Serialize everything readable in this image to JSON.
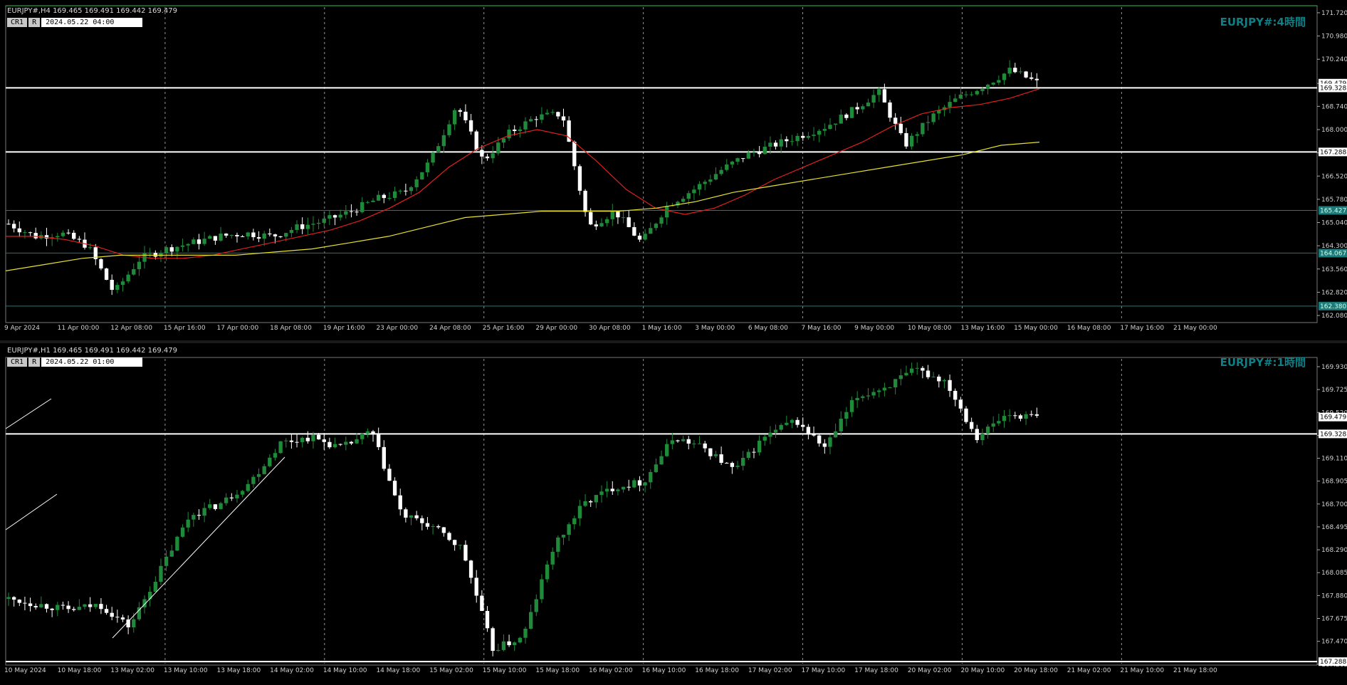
{
  "panes": [
    {
      "id": "h4",
      "header": "EURJPY#,H4  169.465 169.491 169.442 169.479",
      "badge1": "CR1",
      "badge2": "R",
      "datetime": "2024.05.22 04:00",
      "watermark": "EURJPY#:4時間",
      "price_labels": [
        "171.720",
        "170.980",
        "170.240",
        "169.470",
        "168.740",
        "168.000",
        "167.260",
        "166.520",
        "165.780",
        "165.040",
        "164.300",
        "163.560",
        "162.820",
        "162.080"
      ],
      "marker_labels": [
        "169.479",
        "169.328",
        "167.288",
        "165.427",
        "164.067",
        "162.380"
      ],
      "time_labels": [
        "9 Apr 2024",
        "11 Apr 00:00",
        "12 Apr 08:00",
        "15 Apr 16:00",
        "17 Apr 00:00",
        "18 Apr 08:00",
        "19 Apr 16:00",
        "23 Apr 00:00",
        "24 Apr 08:00",
        "25 Apr 16:00",
        "29 Apr 00:00",
        "30 Apr 08:00",
        "1 May 16:00",
        "3 May 00:00",
        "6 May 08:00",
        "7 May 16:00",
        "9 May 00:00",
        "10 May 08:00",
        "13 May 16:00",
        "15 May 00:00",
        "16 May 08:00",
        "17 May 16:00",
        "21 May 00:00"
      ]
    },
    {
      "id": "h1",
      "header": "EURJPY#,H1  169.465 169.491 169.442 169.479",
      "badge1": "CR1",
      "badge2": "R",
      "datetime": "2024.05.22 01:00",
      "watermark": "EURJPY#:1時間",
      "price_labels": [
        "169.930",
        "169.725",
        "169.520",
        "169.315",
        "169.110",
        "168.905",
        "168.700",
        "168.495",
        "168.290",
        "168.085",
        "167.880",
        "167.675",
        "167.470",
        "167.265"
      ],
      "marker_labels": [
        "169.479",
        "169.328",
        "167.288"
      ],
      "time_labels": [
        "10 May 2024",
        "10 May 18:00",
        "13 May 02:00",
        "13 May 10:00",
        "13 May 18:00",
        "14 May 02:00",
        "14 May 10:00",
        "14 May 18:00",
        "15 May 02:00",
        "15 May 10:00",
        "15 May 18:00",
        "16 May 02:00",
        "16 May 10:00",
        "16 May 18:00",
        "17 May 02:00",
        "17 May 10:00",
        "17 May 18:00",
        "20 May 02:00",
        "20 May 10:00",
        "20 May 18:00",
        "21 May 02:00",
        "21 May 10:00",
        "21 May 18:00"
      ]
    }
  ],
  "chart_data": [
    {
      "type": "candlestick",
      "title": "EURJPY#,H4",
      "ylim": [
        161.9,
        171.9
      ],
      "horizontal_levels": [
        169.328,
        167.288,
        165.427,
        164.067,
        162.38
      ],
      "ma_series": [
        {
          "color": "#e02020",
          "values": [
            164.6,
            164.6,
            164.5,
            164.3,
            164.0,
            163.9,
            163.9,
            164.0,
            164.2,
            164.4,
            164.6,
            164.8,
            165.1,
            165.5,
            166.0,
            166.8,
            167.4,
            167.8,
            168.0,
            167.8,
            167.0,
            166.1,
            165.5,
            165.3,
            165.5,
            165.9,
            166.4,
            166.8,
            167.2,
            167.6,
            168.1,
            168.5,
            168.7,
            168.8,
            169.0,
            169.3
          ]
        },
        {
          "color": "#e8e030",
          "values": [
            163.5,
            163.7,
            163.9,
            164.0,
            164.0,
            164.0,
            164.0,
            164.1,
            164.2,
            164.4,
            164.6,
            164.9,
            165.2,
            165.3,
            165.4,
            165.4,
            165.4,
            165.5,
            165.7,
            166.0,
            166.2,
            166.4,
            166.6,
            166.8,
            167.0,
            167.2,
            167.5,
            167.6
          ]
        }
      ],
      "candles_count": 190
    },
    {
      "type": "candlestick",
      "title": "EURJPY#,H1",
      "ylim": [
        167.27,
        170.0
      ],
      "horizontal_levels": [
        169.328,
        167.288
      ],
      "candles_count": 190
    }
  ],
  "colors": {
    "bull": "#1f8a3a",
    "bear": "#ffffff",
    "grid": "#bbbbbb",
    "line_level": "#ffffff",
    "line_cyan": "#1d7a7a",
    "axis_text": "#d0d0d0"
  }
}
